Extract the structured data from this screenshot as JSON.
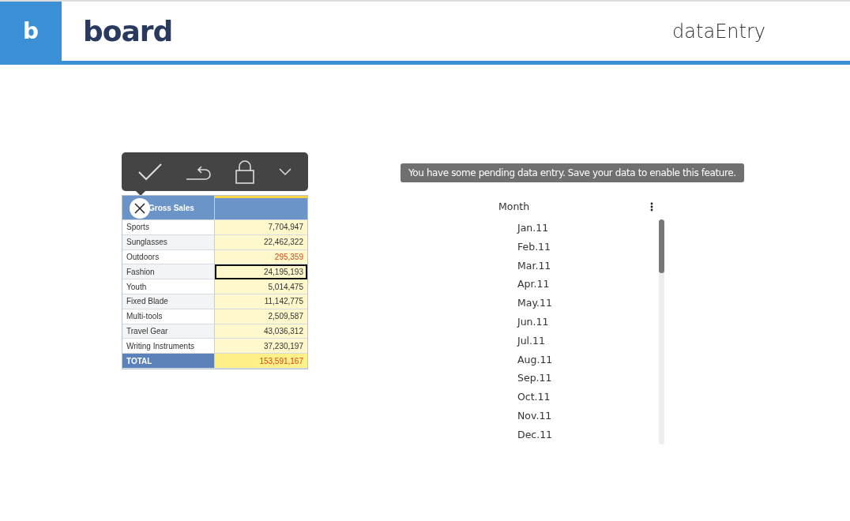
{
  "header": {
    "app_letter": "b",
    "logo": "board",
    "title": "dataEntry"
  },
  "toolbar": {
    "items": [
      {
        "kind": "check"
      },
      {
        "kind": "undo"
      },
      {
        "kind": "lock"
      },
      {
        "kind": "more"
      }
    ]
  },
  "table": {
    "columns": [
      "Gross Sales"
    ],
    "rows": [
      {
        "label": "Sports",
        "value": "7,704,947",
        "kind": "data",
        "changed": false,
        "selected": false
      },
      {
        "label": "Sunglasses",
        "value": "22,462,322",
        "kind": "data",
        "changed": false,
        "selected": false
      },
      {
        "label": "Outdoors",
        "value": "295,359",
        "kind": "data",
        "changed": true,
        "selected": false
      },
      {
        "label": "Fashion",
        "value": "24,195,193",
        "kind": "data",
        "changed": false,
        "selected": true
      },
      {
        "label": "Youth",
        "value": "5,014,475",
        "kind": "data",
        "changed": false,
        "selected": false
      },
      {
        "label": "Fixed Blade",
        "value": "11,142,775",
        "kind": "data",
        "changed": false,
        "selected": false
      },
      {
        "label": "Multi-tools",
        "value": "2,509,587",
        "kind": "data",
        "changed": false,
        "selected": false
      },
      {
        "label": "Travel Gear",
        "value": "43,036,312",
        "kind": "data",
        "changed": false,
        "selected": false
      },
      {
        "label": "Writing Instruments",
        "value": "37,230,197",
        "kind": "data",
        "changed": false,
        "selected": false
      },
      {
        "label": "TOTAL",
        "value": "153,591,167",
        "kind": "total",
        "changed": true,
        "selected": false
      }
    ]
  },
  "tooltip": "You have some pending data entry. Save your data to enable this feature.",
  "selector": {
    "title": "Month",
    "items": [
      "Jan.11",
      "Feb.11",
      "Mar.11",
      "Apr.11",
      "May.11",
      "Jun.11",
      "Jul.11",
      "Aug.11",
      "Sep.11",
      "Oct.11",
      "Nov.11",
      "Dec.11"
    ]
  }
}
